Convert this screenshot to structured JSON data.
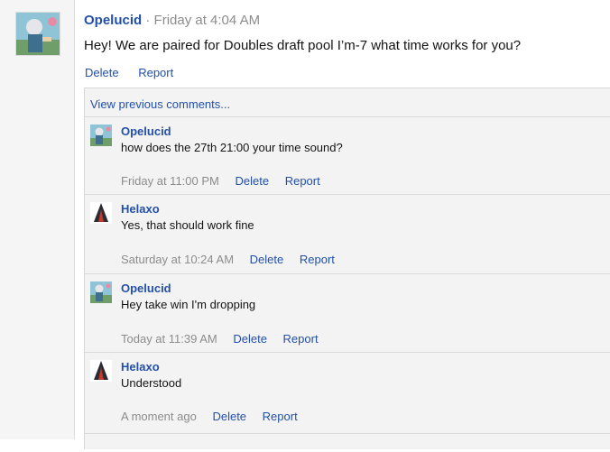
{
  "post": {
    "author": "Opelucid",
    "separator": "·",
    "time": "Friday at 4:04 AM",
    "message": "Hey! We are paired for Doubles draft pool I’m-7 what time works for you?",
    "actions": {
      "delete": "Delete",
      "report": "Report"
    }
  },
  "comments_section": {
    "view_previous": "View previous comments...",
    "items": [
      {
        "author": "Opelucid",
        "text": "how does the 27th 21:00 your time sound?",
        "time": "Friday at 11:00 PM",
        "delete": "Delete",
        "report": "Report"
      },
      {
        "author": "Helaxo",
        "text": "Yes, that should work fine",
        "time": "Saturday at 10:24 AM",
        "delete": "Delete",
        "report": "Report"
      },
      {
        "author": "Opelucid",
        "text": "Hey take win I'm dropping",
        "time": "Today at 11:39 AM",
        "delete": "Delete",
        "report": "Report"
      },
      {
        "author": "Helaxo",
        "text": "Understood",
        "time": "A moment ago",
        "delete": "Delete",
        "report": "Report"
      }
    ]
  },
  "colors": {
    "link": "#2350a8",
    "muted": "#8c8c8c",
    "comment_bg": "#f3f3f3"
  }
}
